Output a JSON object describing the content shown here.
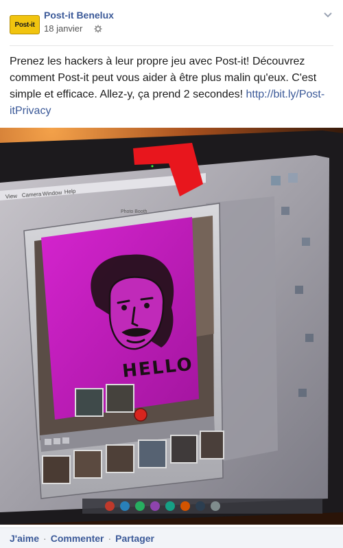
{
  "post": {
    "page_name": "Post-it Benelux",
    "avatar_text": "Post-it",
    "date": "18 janvier",
    "text": "Prenez les hackers à leur propre jeu avec Post-it! Découvrez comment Post-it peut vous aider à être plus malin qu'eux. C'est simple et efficace. Allez-y, ça prend 2 secondes! ",
    "link": "http://bit.ly/Post-itPrivacy"
  },
  "photo": {
    "menu_items": [
      "View",
      "Camera",
      "Window",
      "Help"
    ],
    "window_title": "Photo Booth",
    "sticky_note_text": "HELLO"
  },
  "actions": {
    "like": "J'aime",
    "comment": "Commenter",
    "share": "Partager",
    "separator": "·"
  },
  "colors": {
    "link_blue": "#3b5998",
    "sticky_note_magenta": "#c21fbe",
    "tab_red": "#e8161d",
    "avatar_yellow": "#f1c40f"
  }
}
